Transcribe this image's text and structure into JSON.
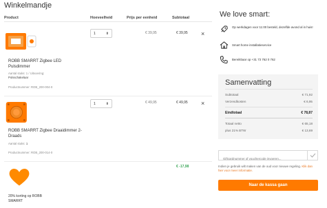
{
  "page": {
    "title": "Winkelmandje"
  },
  "cart": {
    "headers": {
      "product": "Product",
      "quantity": "Hoeveelheid",
      "unit_price": "Prijs per eenheid",
      "subtotal": "Subtotaal"
    },
    "items": [
      {
        "name": "ROBB SMARRT Zigbee LED Pulsdimmer",
        "qty": "1",
        "unit_price": "€ 39,95",
        "subtotal": "€ 39,95",
        "meta1_label": "Aantal stuks: 1 / Uitvoering:",
        "meta1_value": "Polsschakelaar",
        "meta2": "Productnummer: ROB_200-004-0",
        "image_color": "#ff7a00"
      },
      {
        "name": "ROBB SMARRT Zigbee Draaidimmer 2-Draads",
        "qty": "1",
        "unit_price": "€ 49,95",
        "subtotal": "€ 49,95",
        "meta1_label": "Aantal stuks:",
        "meta1_value": "1",
        "meta2": "Productnummer: ROB_200-014-0",
        "image_color": "#ff7a00"
      },
      {
        "name": "20% korting op ROBB SMARRT",
        "subtotal": "€ -17,98",
        "image_color": "#ff8a00"
      }
    ],
    "remove_symbol": "×",
    "qty_caret": "⬍"
  },
  "promo": {
    "title": "We love smart:",
    "rows": [
      {
        "icon": "rocket-icon",
        "text": "Op werkdagen voor 11:00 besteld, dezelfde avond al in huis!"
      },
      {
        "icon": "home-service-icon",
        "text": "Smart home installatieservice"
      },
      {
        "icon": "phone-icon",
        "text": "Bereikbaar op +31 73 762 0 762"
      }
    ]
  },
  "summary": {
    "title": "Samenvatting",
    "subtotal_label": "Subtotaal",
    "subtotal_value": "€ 71,92",
    "shipping_label": "Verzendkosten",
    "shipping_value": "€ 6,95",
    "total_label": "Eindtotaal",
    "total_value": "€ 78,87",
    "net_label": "Totaal netto",
    "net_value": "€ 65,18",
    "vat_label": "plus 21% BTW",
    "vat_value": "€ 13,69"
  },
  "coupon": {
    "placeholder": "Giftcardnummer of vouchercode invoeren..."
  },
  "notice": {
    "text": "Indien je gebruik wilt maken van de oud voor nieuwe regeling.",
    "link": "Klik dan hier voor meer informatie."
  },
  "checkout": {
    "label": "Naar de kassa gaan"
  },
  "colors": {
    "accent": "#ff7a00",
    "discount": "#3aa657"
  }
}
